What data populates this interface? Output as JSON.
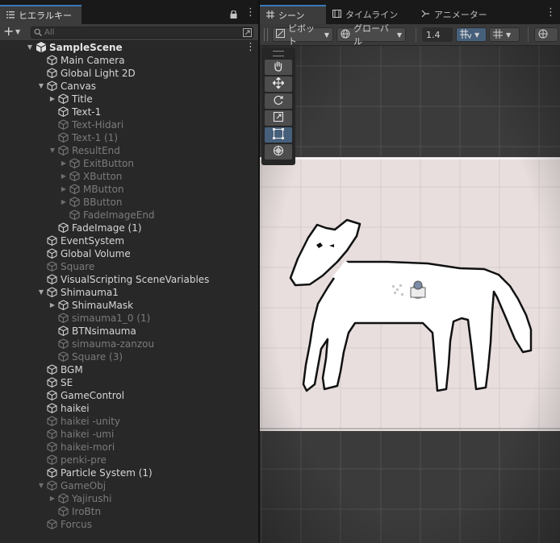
{
  "hierarchy": {
    "tab_label": "ヒエラルキー",
    "add_label": "+",
    "search_placeholder": "All",
    "items": [
      {
        "label": "SampleScene",
        "depth": 0,
        "arrow": "down",
        "kind": "scene",
        "active": true
      },
      {
        "label": "Main Camera",
        "depth": 1,
        "arrow": "none",
        "active": true
      },
      {
        "label": "Global Light 2D",
        "depth": 1,
        "arrow": "none",
        "active": true
      },
      {
        "label": "Canvas",
        "depth": 1,
        "arrow": "down",
        "active": true
      },
      {
        "label": "Title",
        "depth": 2,
        "arrow": "right",
        "active": true
      },
      {
        "label": "Text-1",
        "depth": 2,
        "arrow": "none",
        "active": true
      },
      {
        "label": "Text-Hidari",
        "depth": 2,
        "arrow": "none",
        "active": false
      },
      {
        "label": "Text-1 (1)",
        "depth": 2,
        "arrow": "none",
        "active": false
      },
      {
        "label": "ResultEnd",
        "depth": 2,
        "arrow": "down",
        "active": false
      },
      {
        "label": "ExitButton",
        "depth": 3,
        "arrow": "right",
        "active": false
      },
      {
        "label": "XButton",
        "depth": 3,
        "arrow": "right",
        "active": false
      },
      {
        "label": "MButton",
        "depth": 3,
        "arrow": "right",
        "active": false
      },
      {
        "label": "BButton",
        "depth": 3,
        "arrow": "right",
        "active": false
      },
      {
        "label": "FadeImageEnd",
        "depth": 3,
        "arrow": "none",
        "active": false
      },
      {
        "label": "FadeImage (1)",
        "depth": 2,
        "arrow": "none",
        "active": true
      },
      {
        "label": "EventSystem",
        "depth": 1,
        "arrow": "none",
        "active": true
      },
      {
        "label": "Global Volume",
        "depth": 1,
        "arrow": "none",
        "active": true
      },
      {
        "label": "Square",
        "depth": 1,
        "arrow": "none",
        "active": false
      },
      {
        "label": "VisualScripting SceneVariables",
        "depth": 1,
        "arrow": "none",
        "active": true
      },
      {
        "label": "Shimauma1",
        "depth": 1,
        "arrow": "down",
        "active": true
      },
      {
        "label": "ShimauMask",
        "depth": 2,
        "arrow": "right",
        "active": true
      },
      {
        "label": "simauma1_0 (1)",
        "depth": 2,
        "arrow": "none",
        "active": false
      },
      {
        "label": "BTNsimauma",
        "depth": 2,
        "arrow": "none",
        "active": true
      },
      {
        "label": "simauma-zanzou",
        "depth": 2,
        "arrow": "none",
        "active": false
      },
      {
        "label": "Square (3)",
        "depth": 2,
        "arrow": "none",
        "active": false
      },
      {
        "label": "BGM",
        "depth": 1,
        "arrow": "none",
        "active": true
      },
      {
        "label": "SE",
        "depth": 1,
        "arrow": "none",
        "active": true
      },
      {
        "label": "GameControl",
        "depth": 1,
        "arrow": "none",
        "active": true
      },
      {
        "label": "haikei",
        "depth": 1,
        "arrow": "none",
        "active": true
      },
      {
        "label": "haikei -unity",
        "depth": 1,
        "arrow": "none",
        "active": false
      },
      {
        "label": "haikei -umi",
        "depth": 1,
        "arrow": "none",
        "active": false
      },
      {
        "label": "haikei-mori",
        "depth": 1,
        "arrow": "none",
        "active": false
      },
      {
        "label": "penki-pre",
        "depth": 1,
        "arrow": "none",
        "active": false
      },
      {
        "label": "Particle System (1)",
        "depth": 1,
        "arrow": "none",
        "active": true
      },
      {
        "label": "GameObj",
        "depth": 1,
        "arrow": "down",
        "active": false
      },
      {
        "label": "Yajirushi",
        "depth": 2,
        "arrow": "right",
        "active": false
      },
      {
        "label": "IroBtn",
        "depth": 2,
        "arrow": "none",
        "active": false
      },
      {
        "label": "Forcus",
        "depth": 1,
        "arrow": "none",
        "active": false
      }
    ]
  },
  "scene_tabs": {
    "scene": "シーン",
    "timeline": "タイムライン",
    "animator": "アニメーター"
  },
  "scene_toolbar": {
    "pivot": "ピボット",
    "space": "グローバル",
    "snap_value": "1.4"
  },
  "tools": [
    "hand-tool",
    "move-tool",
    "rotate-tool",
    "scale-tool",
    "rect-tool",
    "transform-tool"
  ],
  "selected_tool": "rect-tool",
  "colors": {
    "accent": "#3a79bb",
    "panel": "#282828",
    "game_view_bg": "#e6dcdc",
    "viewport_bg": "#3b3b3b"
  }
}
